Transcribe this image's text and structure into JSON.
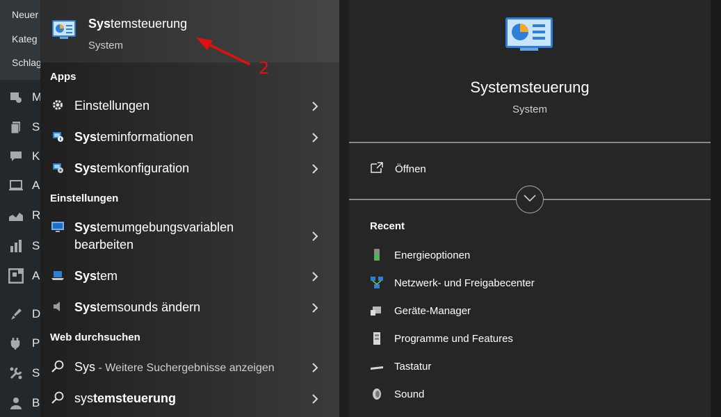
{
  "wp_sidebar": {
    "sub_items": [
      "Neuer",
      "Kateg",
      "Schlag"
    ],
    "menu_initials": [
      "M",
      "S",
      "K",
      "A",
      "R",
      "S",
      "A",
      "D",
      "P",
      "S",
      "B"
    ]
  },
  "best_match": {
    "title_bold": "Sys",
    "title_rest": "temsteuerung",
    "subtitle": "System"
  },
  "sections": {
    "apps": "Apps",
    "settings": "Einstellungen",
    "web": "Web durchsuchen"
  },
  "apps": [
    {
      "bold": "",
      "rest": "Einstellungen",
      "icon": "gear-icon"
    },
    {
      "bold": "Sys",
      "rest": "teminformationen",
      "icon": "system-information-icon"
    },
    {
      "bold": "Sys",
      "rest": "temkonfiguration",
      "icon": "system-configuration-icon"
    }
  ],
  "settings": [
    {
      "bold": "Sys",
      "rest": "temumgebungsvariablen",
      "line2": "bearbeiten",
      "icon": "monitor-icon"
    },
    {
      "bold": "Sys",
      "rest": "tem",
      "icon": "laptop-icon"
    },
    {
      "bold": "Sys",
      "rest": "temsounds ändern",
      "icon": "speaker-icon"
    }
  ],
  "web": [
    {
      "query": "Sys",
      "hint": " - Weitere Suchergebnisse anzeigen",
      "icon": "search-icon"
    },
    {
      "prefix": "sys",
      "bold": "temsteuerung",
      "icon": "search-icon"
    }
  ],
  "detail": {
    "title": "Systemsteuerung",
    "subtitle": "System",
    "open_label": "Öffnen",
    "recent_heading": "Recent",
    "recent": [
      {
        "label": "Energieoptionen",
        "icon": "battery-icon"
      },
      {
        "label": "Netzwerk- und Freigabecenter",
        "icon": "network-icon"
      },
      {
        "label": "Geräte-Manager",
        "icon": "device-manager-icon"
      },
      {
        "label": "Programme und Features",
        "icon": "programs-icon"
      },
      {
        "label": "Tastatur",
        "icon": "keyboard-icon"
      },
      {
        "label": "Sound",
        "icon": "sound-icon"
      }
    ]
  },
  "annotation": {
    "number": "2",
    "color": "#e01010"
  },
  "colors": {
    "accent_blue": "#2d7fd8",
    "control_panel_orange": "#f5a623"
  }
}
